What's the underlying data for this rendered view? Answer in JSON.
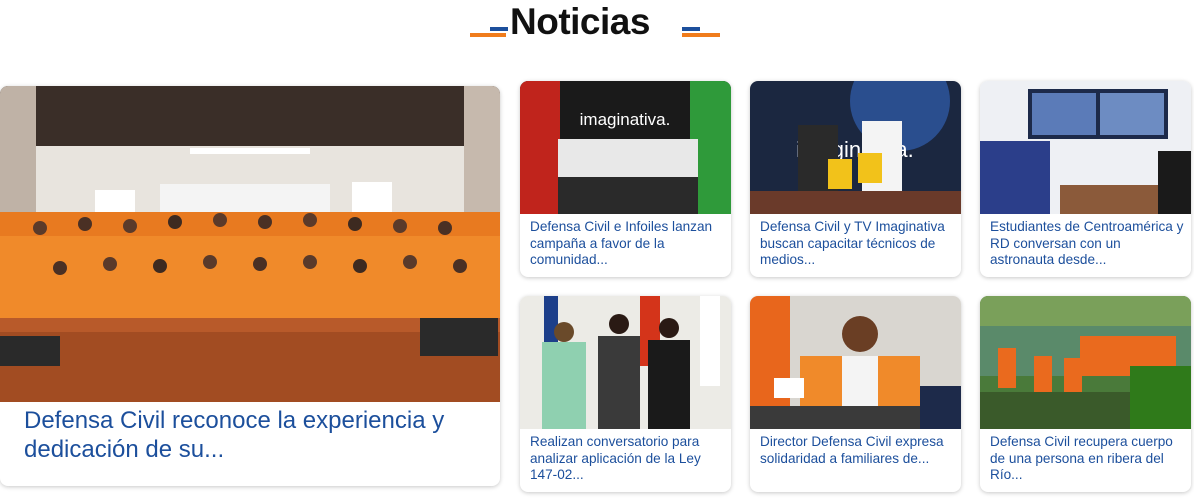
{
  "section": {
    "title": "Noticias"
  },
  "featured": {
    "caption": "Defensa Civil reconoce la experiencia y dedicación de su..."
  },
  "news": [
    {
      "caption": "Defensa Civil e Infoiles lanzan campaña a favor de la comunidad...",
      "image_text": "imaginativa."
    },
    {
      "caption": "Defensa Civil y TV Imaginativa buscan capacitar técnicos de medios...",
      "image_text": "imaginativa."
    },
    {
      "caption": "Estudiantes de Centroamérica y RD conversan con un astronauta desde..."
    },
    {
      "caption": "Realizan conversatorio para analizar aplicación de la Ley 147-02..."
    },
    {
      "caption": "Director Defensa Civil expresa solidaridad a familiares de..."
    },
    {
      "caption": "Defensa Civil recupera cuerpo de una persona en ribera del Río..."
    }
  ],
  "colors": {
    "brand_blue": "#1c4f9c",
    "brand_orange": "#f07c1c",
    "title": "#111111"
  }
}
